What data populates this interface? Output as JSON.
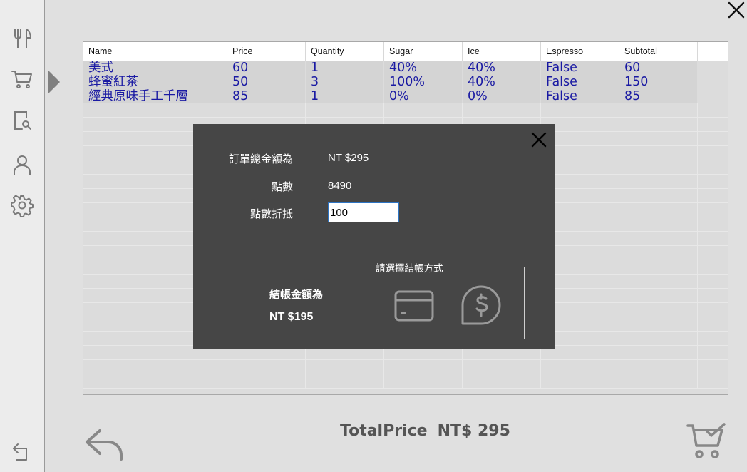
{
  "table": {
    "columns": [
      "Name",
      "Price",
      "Quantity",
      "Sugar",
      "Ice",
      "Espresso",
      "Subtotal"
    ],
    "rows": [
      [
        "美式",
        "60",
        "1",
        "40%",
        "40%",
        "False",
        "60"
      ],
      [
        "蜂蜜紅茶",
        "50",
        "3",
        "100%",
        "40%",
        "False",
        "150"
      ],
      [
        "經典原味手工千層",
        "85",
        "1",
        "0%",
        "0%",
        "False",
        "85"
      ]
    ]
  },
  "modal": {
    "order_total_label": "訂單總金額為",
    "order_total_value": "NT $295",
    "points_label": "點數",
    "points_value": "8490",
    "redeem_label": "點數折抵",
    "redeem_input_value": "100",
    "payment_legend": "請選擇結帳方式",
    "final_label": "結帳金額為",
    "final_value": "NT $195"
  },
  "footer": {
    "total_label": "TotalPrice",
    "total_value": "NT$ 295"
  },
  "sidebar": {
    "items": [
      "utensils-icon",
      "cart-icon",
      "receipt-search-icon",
      "user-icon",
      "gear-icon",
      "logout-icon"
    ]
  },
  "colors": {
    "modal_bg": "#464646",
    "row_text": "#1a1aa3",
    "icon_gray": "#7a7a7a"
  }
}
